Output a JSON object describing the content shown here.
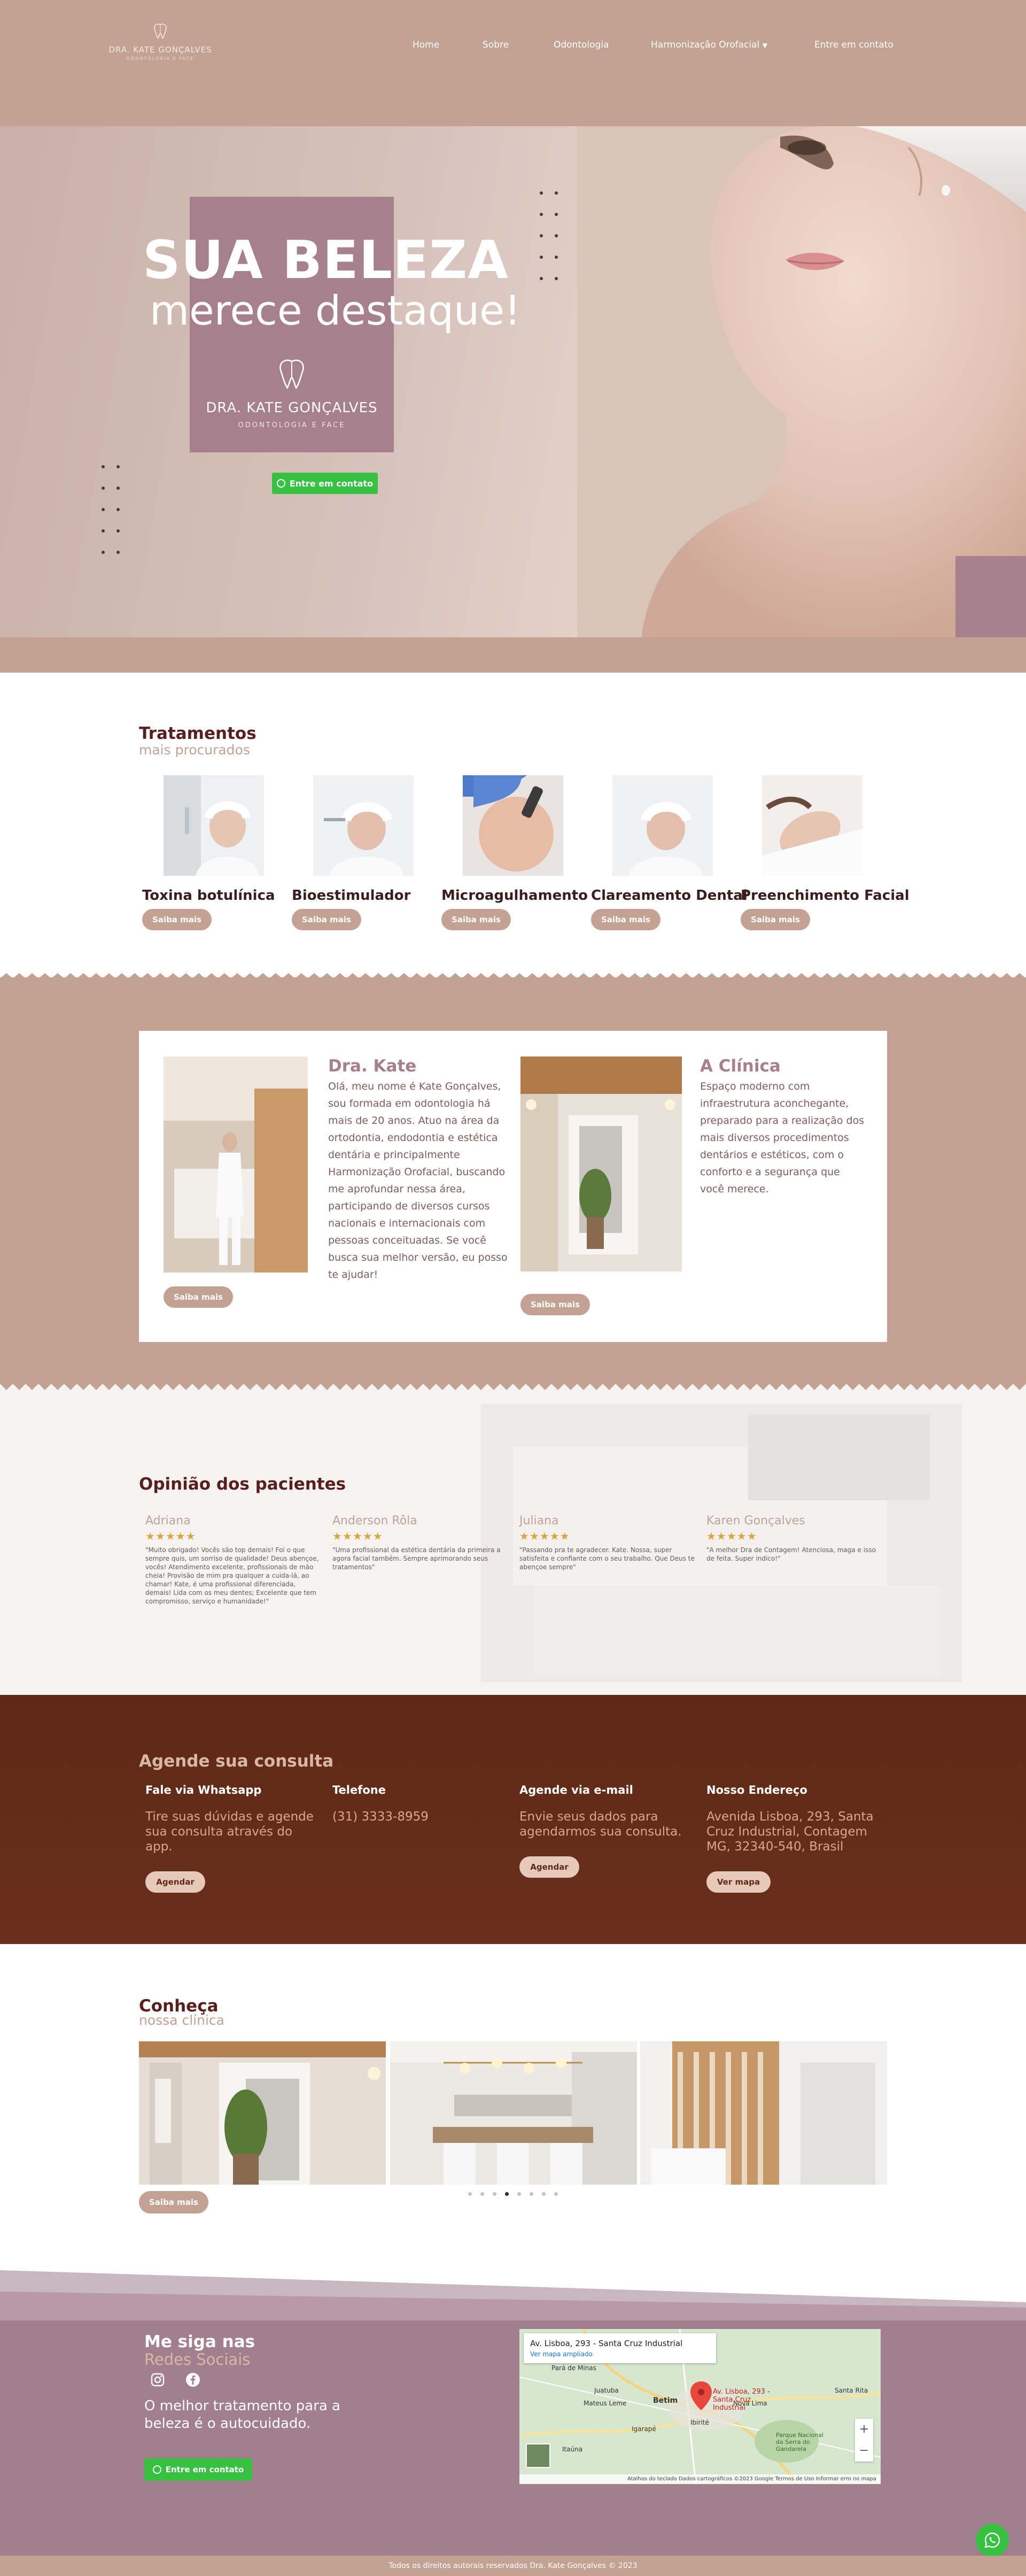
{
  "header": {
    "logo_name": "DRA. KATE GONÇALVES",
    "logo_sub": "ODONTOLOGIA E FACE",
    "nav": [
      "Home",
      "Sobre",
      "Odontologia",
      "Harmonização Orofacial",
      "Entre em contato"
    ]
  },
  "hero": {
    "title": "SUA BELEZA",
    "subtitle": "merece destaque!",
    "brand_name": "DRA. KATE GONÇALVES",
    "brand_sub": "ODONTOLOGIA E FACE",
    "cta": "Entre em contato"
  },
  "treatments": {
    "title": "Tratamentos",
    "subtitle": "mais procurados",
    "items": [
      {
        "label": "Toxina botulínica",
        "button": "Saiba mais"
      },
      {
        "label": "Bioestimulador",
        "button": "Saiba mais"
      },
      {
        "label": "Microagulhamento",
        "button": "Saiba mais"
      },
      {
        "label": "Clareamento Dental",
        "button": "Saiba mais"
      },
      {
        "label": "Preenchimento Facial",
        "button": "Saiba mais"
      }
    ]
  },
  "about": {
    "doctor_title": "Dra. Kate",
    "doctor_text": "Olá, meu nome é Kate Gonçalves, sou formada em odontologia há mais de 20 anos. Atuo na área da ortodontia, endodontia e estética dentária e principalmente Harmonização Orofacial, buscando me aprofundar nessa área, participando de diversos cursos nacionais e internacionais com pessoas conceituadas. Se você busca sua melhor versão, eu posso te ajudar!",
    "doctor_button": "Saiba mais",
    "clinic_title": "A Clínica",
    "clinic_text": "Espaço moderno com infraestrutura aconchegante, preparado para a realização dos mais diversos procedimentos dentários e estéticos, com o conforto e a segurança que você merece.",
    "clinic_button": "Saiba mais"
  },
  "reviews": {
    "title": "Opinião dos pacientes",
    "items": [
      {
        "name": "Adriana",
        "stars": 5,
        "text": "\"Muito obrigado! Vocês são top demais! Foi o que sempre quis, um sorriso de qualidade! Deus abençoe, vocês! Atendimento excelente, profissionais de mão cheia! Provisão de mim pra qualquer a cuida-lá, ao chamar! Kate, é uma profissional diferenciada, demais! Lida com os meu dentes; Excelente que tem compromisso, serviço e humanidade!\""
      },
      {
        "name": "Anderson Rôla",
        "stars": 5,
        "text": "\"Uma profissional da estética dentária da primeira a agora facial também. Sempre aprimorando seus tratamentos\""
      },
      {
        "name": "Juliana",
        "stars": 5,
        "text": "\"Passando pra te agradecer. Kate. Nossa, super satisfeita e confiante com o seu trabalho. Que Deus te abençoe sempre\""
      },
      {
        "name": "Karen Gonçalves",
        "stars": 5,
        "text": "\"A melhor Dra de Contagem! Atenciosa, maga e isso de feita. Super indico!\""
      }
    ]
  },
  "contact": {
    "title": "Agende sua consulta",
    "columns": [
      {
        "heading": "Fale via Whatsapp",
        "body": "Tire suas dúvidas e agende sua consulta através do app.",
        "button": "Agendar"
      },
      {
        "heading": "Telefone",
        "body": "(31) 3333-8959",
        "button": ""
      },
      {
        "heading": "Agende via e-mail",
        "body": "Envie seus dados para agendarmos sua consulta.",
        "button": "Agendar"
      },
      {
        "heading": "Nosso Endereço",
        "body": "Avenida Lisboa, 293, Santa Cruz Industrial, Contagem MG, 32340-540, Brasil",
        "button": "Ver mapa"
      }
    ]
  },
  "gallery": {
    "title": "Conheça",
    "subtitle": "nossa clínica",
    "button": "Saiba mais",
    "dots": 8,
    "active_dot": 4
  },
  "footer": {
    "title": "Me siga nas",
    "subtitle": "Redes Sociais",
    "text": "O melhor tratamento para a beleza é o autocuidado.",
    "cta": "Entre em contato",
    "map": {
      "address": "Av. Lisboa, 293 - Santa Cruz Industrial",
      "link": "Ver mapa ampliado",
      "pin_label": "Av. Lisboa, 293 - Santa Cruz Industrial",
      "places": [
        "Pará de Minas",
        "Juatuba",
        "Mateus Leme",
        "Betim",
        "Ibirité",
        "Igarapé",
        "Nova Lima",
        "Santa Rita",
        "Itaúna",
        "Parque Nacional da Serra do Gandarela"
      ],
      "zoom_in": "+",
      "zoom_out": "−",
      "attribution": "Atalhos do teclado   Dados cartográficos ©2023 Google   Termos de Uso   Informar erro no mapa"
    },
    "copyright": "Todos os direitos autorais reservados Dra. Kate Gonçalves © 2023"
  },
  "colors": {
    "brand_beige": "#c3a293",
    "brand_mauve": "#a7808d",
    "brand_brown": "#5e2917",
    "whatsapp_green": "#36c142"
  }
}
